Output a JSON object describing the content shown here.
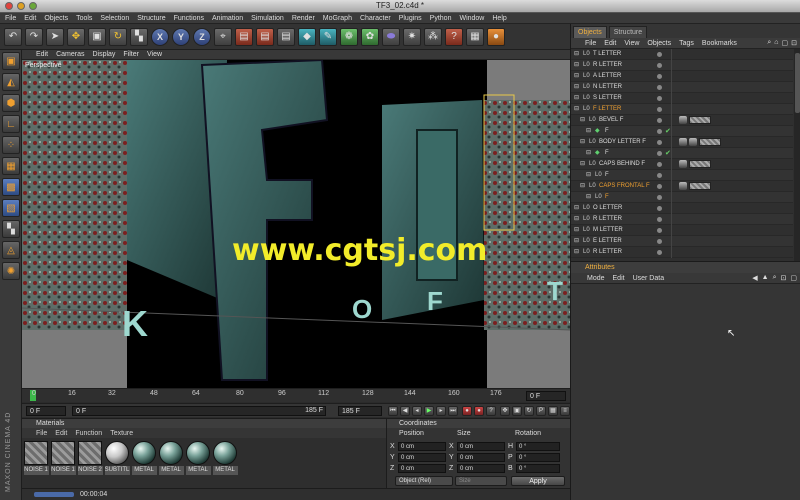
{
  "window": {
    "title": "TF3_02.c4d *"
  },
  "menu": [
    "File",
    "Edit",
    "Objects",
    "Tools",
    "Selection",
    "Structure",
    "Functions",
    "Animation",
    "Simulation",
    "Render",
    "MoGraph",
    "Character",
    "Plugins",
    "Python",
    "Window",
    "Help"
  ],
  "toolbar": {
    "axis_x": "X",
    "axis_y": "Y",
    "axis_z": "Z"
  },
  "viewport": {
    "menu": [
      "Edit",
      "Cameras",
      "Display",
      "Filter",
      "View"
    ],
    "label": "Perspective",
    "watermark": "www.cgtsj.com",
    "overlay_letters": [
      "K",
      "O",
      "F",
      "T"
    ]
  },
  "timeline": {
    "ticks": [
      "0",
      "16",
      "32",
      "48",
      "64",
      "80",
      "96",
      "112",
      "128",
      "144",
      "160",
      "176"
    ],
    "current_frame": "0 F",
    "start_frame": "0 F",
    "range_field": "0 F",
    "end_field": "185 F",
    "end_frame": "185 F"
  },
  "materials": {
    "title": "Materials",
    "menu": [
      "File",
      "Edit",
      "Function",
      "Texture"
    ],
    "items": [
      "NOISE 1",
      "NOISE 1",
      "NOISE 2",
      "SUBTITL",
      "METAL",
      "METAL",
      "METAL",
      "METAL"
    ]
  },
  "coordinates": {
    "title": "Coordinates",
    "headers": [
      "Position",
      "Size",
      "Rotation"
    ],
    "rows": [
      {
        "axis": "X",
        "pos": "0 cm",
        "size_axis": "X",
        "size": "0 cm",
        "rot_axis": "H",
        "rot": "0 °"
      },
      {
        "axis": "Y",
        "pos": "0 cm",
        "size_axis": "Y",
        "size": "0 cm",
        "rot_axis": "P",
        "rot": "0 °"
      },
      {
        "axis": "Z",
        "pos": "0 cm",
        "size_axis": "Z",
        "size": "0 cm",
        "rot_axis": "B",
        "rot": "0 °"
      }
    ],
    "mode": "Object (Rel)",
    "size_mode": "Size",
    "apply_label": "Apply"
  },
  "status": {
    "time": "00:00:04",
    "brand": "MAXON CINEMA 4D"
  },
  "objects_panel": {
    "tabs": [
      "Objects",
      "Structure"
    ],
    "menu": [
      "File",
      "Edit",
      "View",
      "Objects",
      "Tags",
      "Bookmarks"
    ],
    "rows": [
      {
        "name": "T LETTER",
        "indent": 0,
        "hl": false
      },
      {
        "name": "R LETTER",
        "indent": 0,
        "hl": false
      },
      {
        "name": "A LETTER",
        "indent": 0,
        "hl": false
      },
      {
        "name": "N LETTER",
        "indent": 0,
        "hl": false
      },
      {
        "name": "S LETTER",
        "indent": 0,
        "hl": false
      },
      {
        "name": "F LETTER",
        "indent": 0,
        "hl": true
      },
      {
        "name": "BEVEL F",
        "indent": 1,
        "hl": false
      },
      {
        "name": "F",
        "indent": 2,
        "hl": false
      },
      {
        "name": "BODY LETTER F",
        "indent": 1,
        "hl": false
      },
      {
        "name": "F",
        "indent": 2,
        "hl": false
      },
      {
        "name": "CAPS BEHIND F",
        "indent": 1,
        "hl": false
      },
      {
        "name": "F",
        "indent": 2,
        "hl": false
      },
      {
        "name": "CAPS FRONTAL F",
        "indent": 1,
        "hl": true
      },
      {
        "name": "F",
        "indent": 2,
        "hl": true
      },
      {
        "name": "O LETTER",
        "indent": 0,
        "hl": false
      },
      {
        "name": "R LETTER",
        "indent": 0,
        "hl": false
      },
      {
        "name": "M LETTER",
        "indent": 0,
        "hl": false
      },
      {
        "name": "E LETTER",
        "indent": 0,
        "hl": false
      },
      {
        "name": "R LETTER",
        "indent": 0,
        "hl": false
      }
    ]
  },
  "attributes_panel": {
    "title": "Attributes",
    "menu": [
      "Mode",
      "Edit",
      "User Data"
    ]
  }
}
